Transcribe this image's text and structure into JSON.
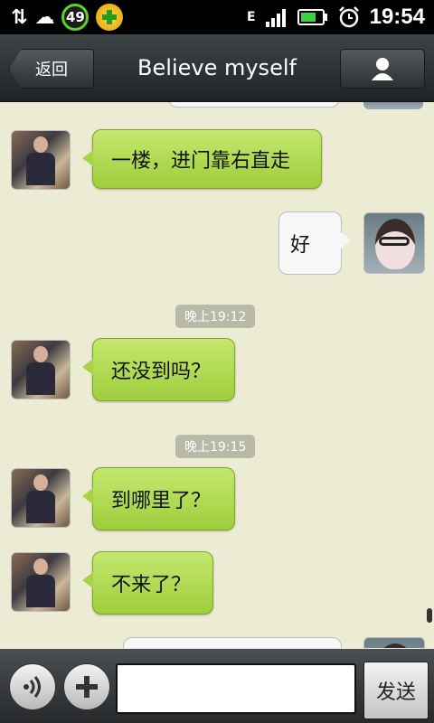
{
  "status_bar": {
    "badge_number": "49",
    "network_label": "E",
    "time": "19:54"
  },
  "header": {
    "back_label": "返回",
    "title": "Believe myself"
  },
  "messages": [
    {
      "side": "left",
      "text": "一楼，进门靠右直走"
    },
    {
      "side": "right",
      "text": "好"
    },
    {
      "timestamp": "晚上19:12"
    },
    {
      "side": "left",
      "text": "还没到吗？"
    },
    {
      "timestamp": "晚上19:15"
    },
    {
      "side": "left",
      "text": "到哪里了？"
    },
    {
      "side": "left",
      "text": "不来了？"
    }
  ],
  "input_bar": {
    "placeholder": "",
    "send_label": "发送"
  },
  "colors": {
    "chat_background": "#ecebd4",
    "green_bubble": "#a8d345",
    "title_bar": "#2f3436"
  }
}
